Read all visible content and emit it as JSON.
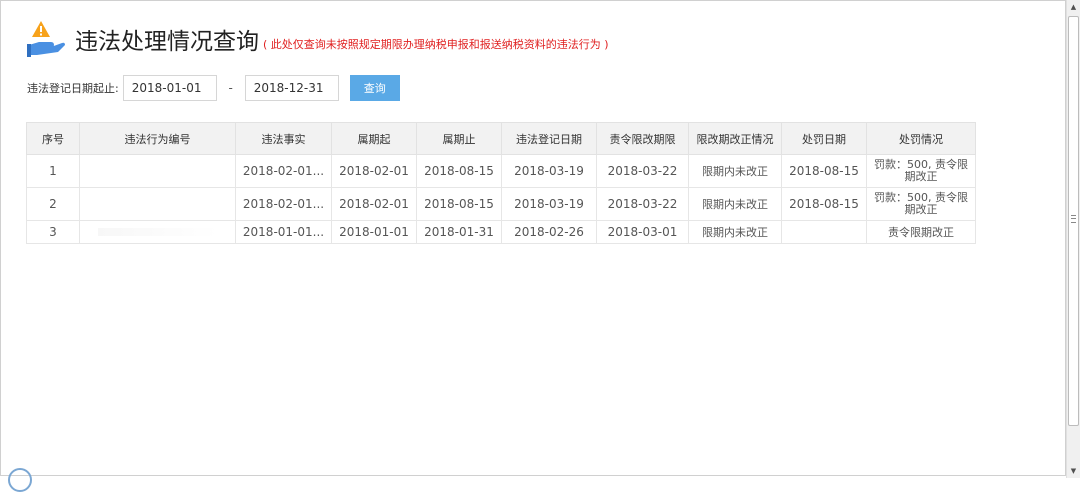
{
  "header": {
    "title": "违法处理情况查询",
    "subtitle": "( 此处仅查询未按照规定期限办理纳税申报和报送纳税资料的违法行为 )",
    "logo_icon": "warning-hand-icon"
  },
  "filter": {
    "label": "违法登记日期起止:",
    "start_date": "2018-01-01",
    "separator": "-",
    "end_date": "2018-12-31",
    "query_label": "查询"
  },
  "table": {
    "headers": [
      "序号",
      "违法行为编号",
      "违法事实",
      "属期起",
      "属期止",
      "违法登记日期",
      "责令限改期限",
      "限改期改正情况",
      "处罚日期",
      "处罚情况"
    ],
    "rows": [
      {
        "seq": "1",
        "code": "",
        "fact": "2018-02-01...",
        "period_start": "2018-02-01",
        "period_end": "2018-08-15",
        "reg_date": "2018-03-19",
        "deadline": "2018-03-22",
        "status": "限期内未改正",
        "penalty_date": "2018-08-15",
        "penalty": "罚款：500, 责令限期改正"
      },
      {
        "seq": "2",
        "code": "",
        "fact": "2018-02-01...",
        "period_start": "2018-02-01",
        "period_end": "2018-08-15",
        "reg_date": "2018-03-19",
        "deadline": "2018-03-22",
        "status": "限期内未改正",
        "penalty_date": "2018-08-15",
        "penalty": "罚款：500, 责令限期改正"
      },
      {
        "seq": "3",
        "code": "",
        "fact": "2018-01-01...",
        "period_start": "2018-01-01",
        "period_end": "2018-01-31",
        "reg_date": "2018-02-26",
        "deadline": "2018-03-01",
        "status": "限期内未改正",
        "penalty_date": "",
        "penalty": "责令限期改正"
      }
    ]
  },
  "colors": {
    "accent": "#5aa9e6",
    "warning": "#e02020",
    "header_bg": "#f2f2f2"
  }
}
